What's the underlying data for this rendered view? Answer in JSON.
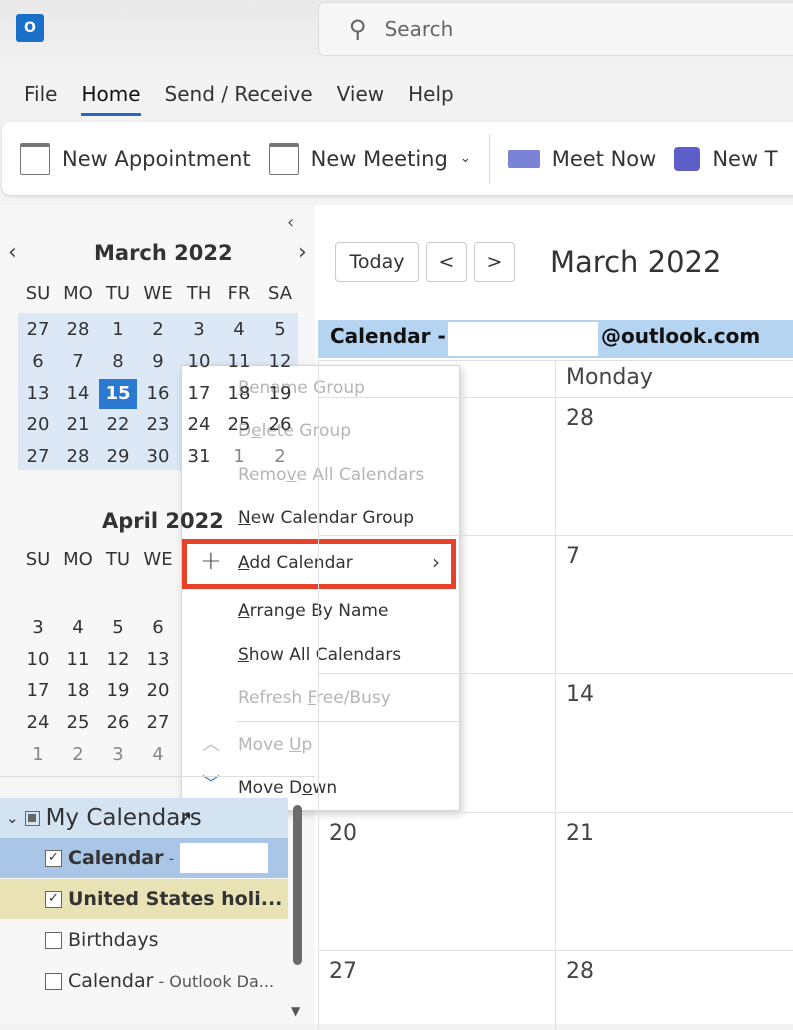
{
  "app": {
    "logo_letter": "O"
  },
  "search": {
    "placeholder": "Search"
  },
  "tabs": [
    "File",
    "Home",
    "Send / Receive",
    "View",
    "Help"
  ],
  "ribbon": {
    "new_appointment": "New Appointment",
    "new_meeting": "New Meeting",
    "meet_now": "Meet Now",
    "new_teams": "New T"
  },
  "weekdays": [
    "SU",
    "MO",
    "TU",
    "WE",
    "TH",
    "FR",
    "SA"
  ],
  "mini_march": {
    "title": "March 2022",
    "weeks": [
      [
        "27",
        "28",
        "1",
        "2",
        "3",
        "4",
        "5"
      ],
      [
        "6",
        "7",
        "8",
        "9",
        "10",
        "11",
        "12"
      ],
      [
        "13",
        "14",
        "15",
        "16",
        "17",
        "18",
        "19"
      ],
      [
        "20",
        "21",
        "22",
        "23",
        "24",
        "25",
        "26"
      ],
      [
        "27",
        "28",
        "29",
        "30",
        "31",
        "1",
        "2"
      ]
    ],
    "today": "15"
  },
  "mini_april": {
    "title": "April 2022",
    "weeks": [
      [
        "3",
        "4",
        "5",
        "6"
      ],
      [
        "10",
        "11",
        "12",
        "13"
      ],
      [
        "17",
        "18",
        "19",
        "20"
      ],
      [
        "24",
        "25",
        "26",
        "27"
      ],
      [
        "1",
        "2",
        "3",
        "4"
      ]
    ]
  },
  "nav": {
    "today": "Today",
    "prev": "<",
    "next": ">",
    "title": "March 2022"
  },
  "calendar_header": {
    "prefix": "Calendar -",
    "suffix": "@outlook.com"
  },
  "column_header": "Monday",
  "sunday_dates": [
    "20",
    "27"
  ],
  "monday_dates": [
    "28",
    "7",
    "14",
    "21",
    "28"
  ],
  "context_menu": [
    {
      "label": "Rename Group",
      "disabled": true
    },
    {
      "label": "Delete Group",
      "disabled": true
    },
    {
      "label": "Remove All Calendars",
      "disabled": true
    },
    {
      "label": "New Calendar Group",
      "disabled": false
    },
    {
      "label": "Add Calendar",
      "disabled": false
    },
    {
      "label": "Arrange By Name",
      "disabled": false
    },
    {
      "label": "Show All Calendars",
      "disabled": false
    },
    {
      "label": "Refresh Free/Busy",
      "disabled": true
    },
    {
      "label": "Move Up",
      "disabled": true
    },
    {
      "label": "Move Down",
      "disabled": false
    }
  ],
  "folders": {
    "group": "My Calendars",
    "items": [
      {
        "name": "Calendar",
        "sub": "-",
        "checked": true,
        "bold": true,
        "color": "#a9c6e6"
      },
      {
        "name": "United States holi...",
        "sub": "",
        "checked": true,
        "bold": true,
        "color": "#e8e2b4"
      },
      {
        "name": "Birthdays",
        "sub": "",
        "checked": false,
        "bold": false,
        "color": ""
      },
      {
        "name": "Calendar",
        "sub": "- Outlook Da...",
        "checked": false,
        "bold": false,
        "color": ""
      }
    ]
  },
  "colors": {
    "accent": "#2b78d0",
    "highlight_box": "#e8412a",
    "calendar_header": "#b4d4f2"
  }
}
